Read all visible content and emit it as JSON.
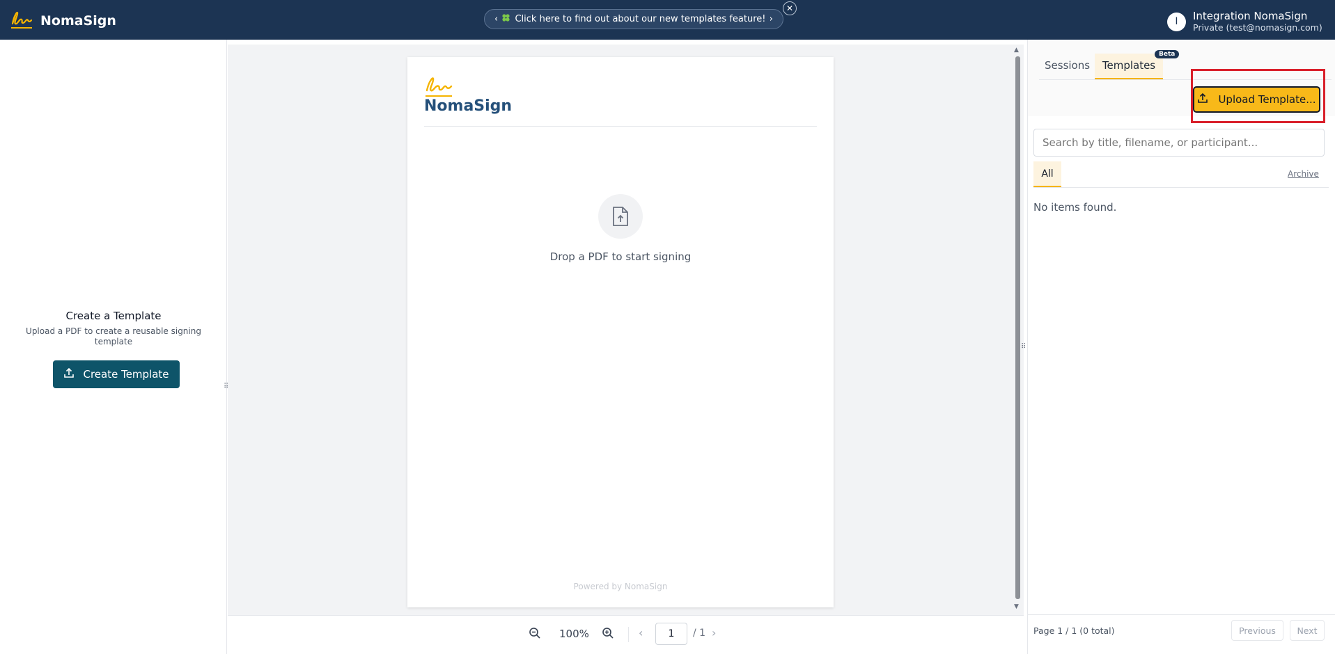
{
  "header": {
    "brand": "NomaSign",
    "announcement": "Click here to find out about our new templates feature!",
    "announcement_icon": "clover",
    "user": {
      "initial": "I",
      "name": "Integration NomaSign",
      "account": "Private (test@nomasign.com)"
    }
  },
  "left_panel": {
    "title": "Create a Template",
    "subtitle": "Upload a PDF to create a reusable signing template",
    "create_button": "Create Template"
  },
  "document": {
    "brand": "NomaSign",
    "drop_text": "Drop a PDF to start signing",
    "powered_by": "Powered by NomaSign"
  },
  "viewer": {
    "zoom": "100%",
    "page_current": "1",
    "page_total": "/ 1"
  },
  "right_panel": {
    "tabs": [
      {
        "label": "Sessions",
        "active": false
      },
      {
        "label": "Templates",
        "active": true,
        "badge": "Beta"
      }
    ],
    "upload_button": "Upload Template...",
    "search_placeholder": "Search by title, filename, or participant...",
    "filters": {
      "all": "All",
      "archive": "Archive"
    },
    "empty_message": "No items found.",
    "pagination": {
      "info": "Page 1 / 1 (0 total)",
      "previous": "Previous",
      "next": "Next"
    }
  },
  "colors": {
    "header_bg": "#1c3453",
    "accent_yellow": "#f8b919",
    "teal_button": "#0e5469",
    "highlight_red": "#d9202b"
  }
}
